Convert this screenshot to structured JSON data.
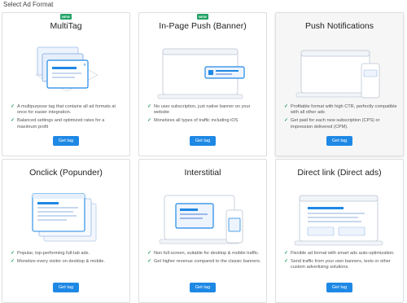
{
  "page": {
    "heading": "Select Ad Format"
  },
  "cards": [
    {
      "title": "MultiTag",
      "badge": "NEW",
      "features": [
        "A multipurpose tag that contains all ad formats at once for easier integration.",
        "Balanced settings and optimized rates for a maximum profit"
      ],
      "button": "Get tag",
      "icon": "multitag-illustration"
    },
    {
      "title": "In-Page Push (Banner)",
      "badge": "NEW",
      "features": [
        "No user subscription, just native banner on your website",
        "Monetizes all types of traffic including iOS"
      ],
      "button": "Get tag",
      "icon": "in-page-push-illustration"
    },
    {
      "title": "Push Notifications",
      "features": [
        "Profitable format with high CTR, perfectly compatible with all other ads",
        "Get paid for each new subscription (CPS) or impression delivered (CPM)."
      ],
      "button": "Get tag",
      "icon": "push-notifications-illustration"
    },
    {
      "title": "Onclick (Popunder)",
      "features": [
        "Popular, top-performing full-tab ads.",
        "Monetize every visitor on desktop & mobile."
      ],
      "button": "Get tag",
      "icon": "onclick-illustration"
    },
    {
      "title": "Interstitial",
      "features": [
        "Non full-screen, suitable for desktop & mobile traffic.",
        "Get higher revenue compared to the classic banners."
      ],
      "button": "Get tag",
      "icon": "interstitial-illustration"
    },
    {
      "title": "Direct link (Direct ads)",
      "features": [
        "Flexible ad format with smart ads auto-optimization.",
        "Send traffic from your own banners, texts or other custom advertising solutions."
      ],
      "button": "Get tag",
      "icon": "direct-link-illustration"
    }
  ],
  "colors": {
    "accent": "#1e88e5",
    "badge": "#21a366",
    "check": "#1f9e5c",
    "selected_card_bg": "#f6f6f6"
  }
}
